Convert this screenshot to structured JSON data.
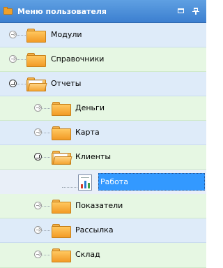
{
  "header": {
    "title": "Меню пользователя",
    "icon": "folder-icon",
    "buttons": [
      "maximize-icon",
      "pin-icon"
    ]
  },
  "tree": {
    "items": [
      {
        "label": "Модули",
        "state": "collapsed",
        "level": 0
      },
      {
        "label": "Справочники",
        "state": "collapsed",
        "level": 0
      },
      {
        "label": "Отчеты",
        "state": "expanded",
        "level": 0
      },
      {
        "label": "Деньги",
        "state": "collapsed",
        "level": 1
      },
      {
        "label": "Карта",
        "state": "collapsed",
        "level": 1
      },
      {
        "label": "Клиенты",
        "state": "expanded",
        "level": 1
      },
      {
        "label": "Работа",
        "state": "selected",
        "level": 2,
        "icon": "report-icon"
      },
      {
        "label": "Показатели",
        "state": "collapsed",
        "level": 1
      },
      {
        "label": "Рассылка",
        "state": "collapsed",
        "level": 1
      },
      {
        "label": "Склад",
        "state": "collapsed",
        "level": 1
      }
    ]
  },
  "colors": {
    "header": "#3c7fd0",
    "row_blue": "#deebf9",
    "row_green": "#e6f7e3",
    "selection": "#3399ff",
    "folder": "#f29a25"
  }
}
